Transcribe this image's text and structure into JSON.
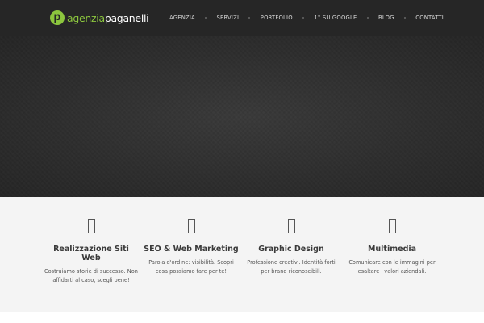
{
  "brand": {
    "logo_mark": "p",
    "name_accent": "agenzia",
    "name_rest": "paganelli",
    "accent_color": "#8cc63e"
  },
  "nav": {
    "items": [
      {
        "label": "AGENZIA"
      },
      {
        "label": "SERVIZI"
      },
      {
        "label": "PORTFOLIO"
      },
      {
        "label": "1° SU GOOGLE"
      },
      {
        "label": "BLOG"
      },
      {
        "label": "CONTATTI"
      }
    ]
  },
  "services": [
    {
      "icon": "broken-glyph-icon",
      "title": "Realizzazione Siti Web",
      "desc": "Costruiamo storie di successo. Non affidarti al caso, scegli bene!"
    },
    {
      "icon": "broken-glyph-icon",
      "title": "SEO & Web Marketing",
      "desc": "Parola d'ordine: visibilità. Scopri cosa possiamo fare per te!"
    },
    {
      "icon": "broken-glyph-icon",
      "title": "Graphic Design",
      "desc": "Professione creativi. Identità forti per brand riconoscibili."
    },
    {
      "icon": "broken-glyph-icon",
      "title": "Multimedia",
      "desc": "Comunicare con le immagini per esaltare i valori aziendali."
    }
  ]
}
